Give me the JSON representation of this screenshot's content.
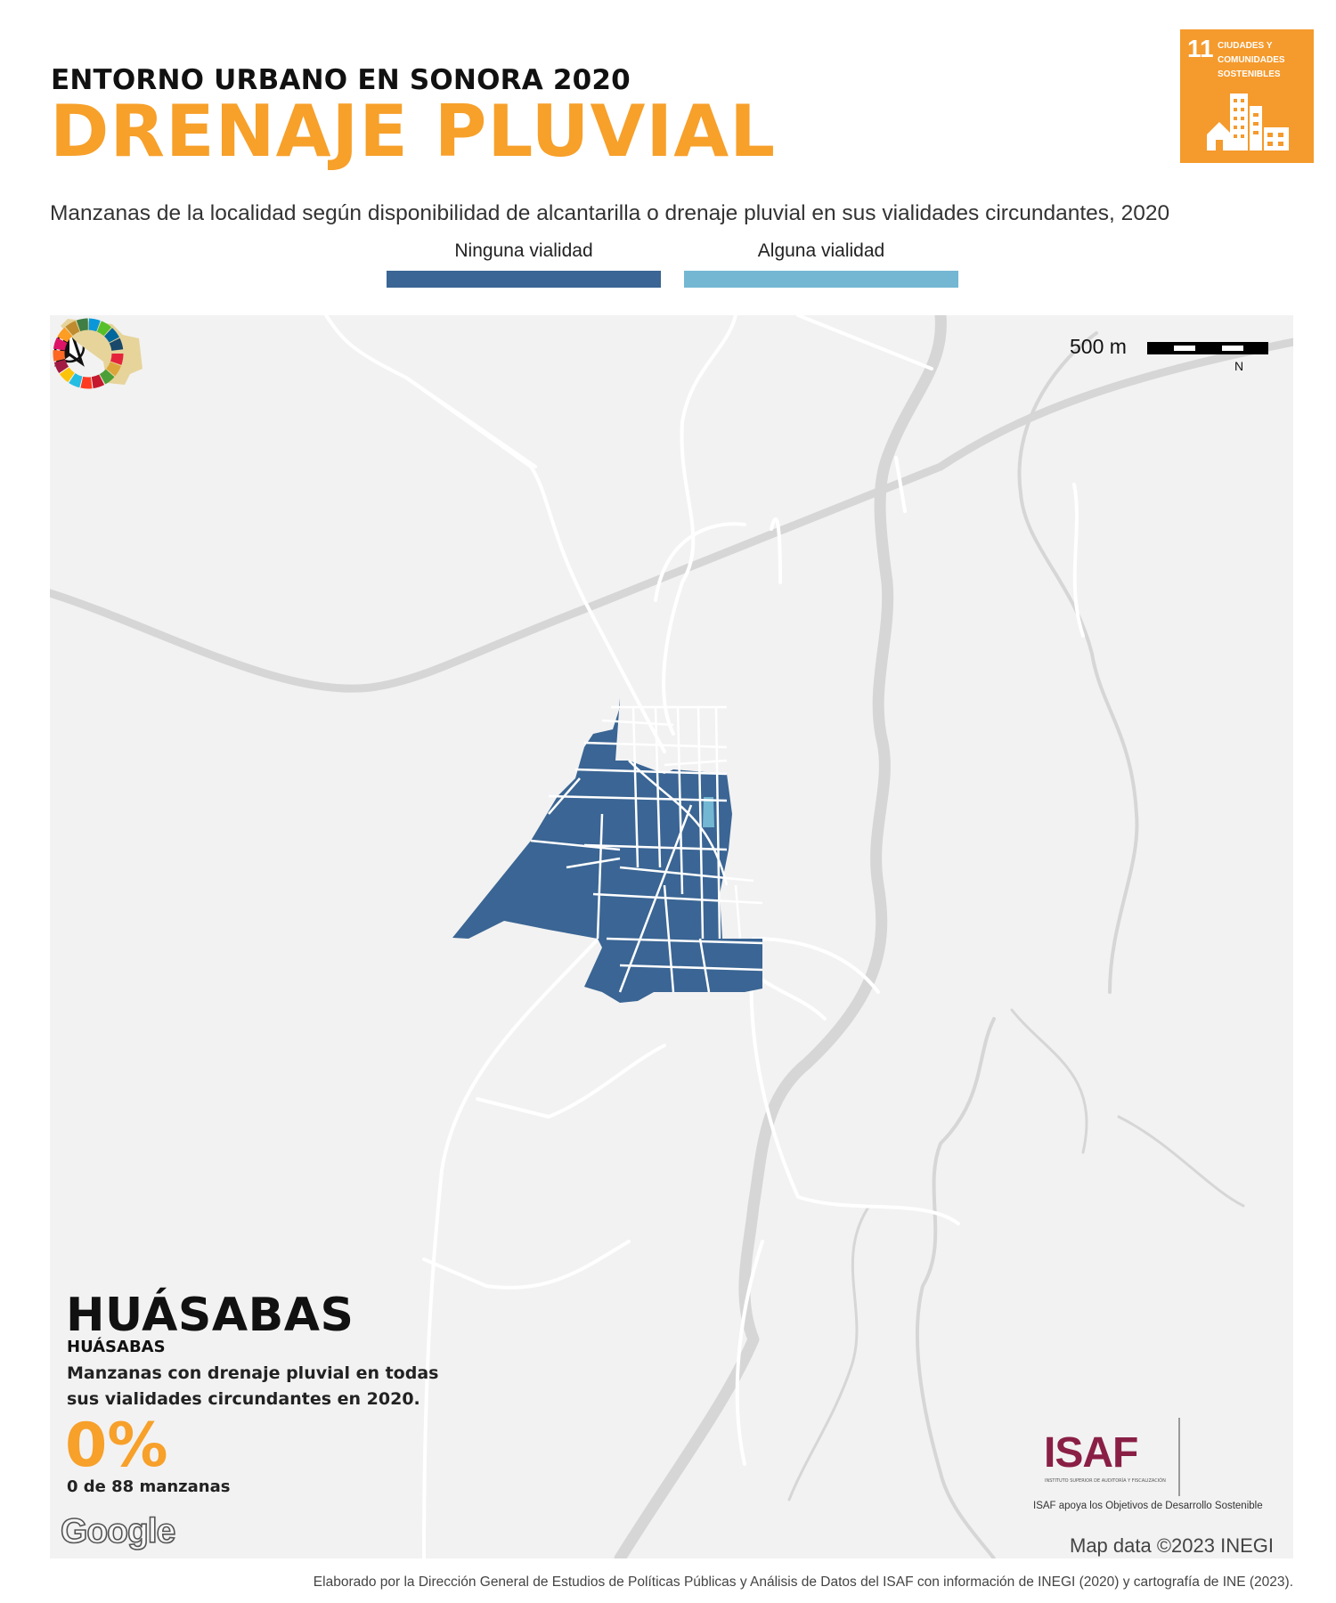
{
  "header": {
    "kicker": "ENTORNO URBANO EN SONORA 2020",
    "title": "DRENAJE PLUVIAL",
    "subtitle": "Manzanas de la localidad según disponibilidad de alcantarilla o drenaje pluvial en sus vialidades circundantes, 2020"
  },
  "sdg_badge": {
    "number": "11",
    "text": "CIUDADES Y COMUNIDADES SOSTENIBLES",
    "color": "#f59a2c"
  },
  "legend": [
    {
      "label": "Ninguna vialidad",
      "color": "#3a6594"
    },
    {
      "label": "Alguna vialidad",
      "color": "#73b7d3"
    }
  ],
  "map": {
    "scale_label": "500 m",
    "north_label": "N",
    "attribution": "Map data ©2023 INEGI",
    "provider_logo": "Google",
    "colors": {
      "background": "#f2f2f2",
      "road": "#d8d8d8",
      "minor_road": "#ffffff",
      "block_none": "#3a6594",
      "block_some": "#73b7d3"
    }
  },
  "info": {
    "municipality": "HUÁSABAS",
    "locality": "HUÁSABAS",
    "description": "Manzanas con drenaje pluvial en todas sus vialidades circundantes en 2020.",
    "percent": "0%",
    "count_text": "0 de 88 manzanas",
    "percent_value": 0,
    "blocks_with_drainage": 0,
    "blocks_total": 88
  },
  "logos": {
    "isaf_name": "ISAF",
    "isaf_fullname": "INSTITUTO SUPERIOR DE AUDITORÍA Y FISCALIZACIÓN",
    "isaf_caption": "ISAF apoya los Objetivos de Desarrollo Sostenible"
  },
  "footer": "Elaborado por la Dirección General de Estudios de Políticas Públicas y Análisis de Datos del ISAF con información de INEGI (2020) y cartografía de INE (2023)."
}
